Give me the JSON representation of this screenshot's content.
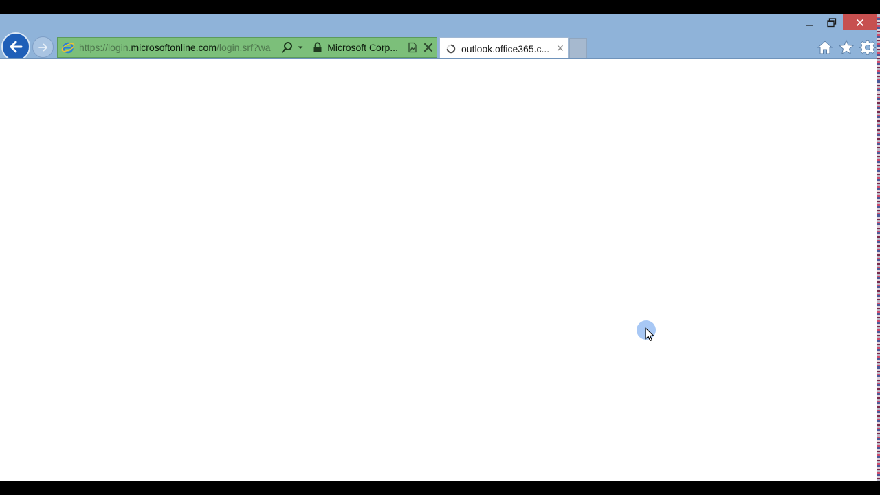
{
  "browser": {
    "address_bar": {
      "url_scheme": "https://",
      "url_sub": "login.",
      "url_host": "microsoftonline.com",
      "url_path": "/login.srf?wa",
      "site_identity": "Microsoft Corp..."
    },
    "tabs": [
      {
        "title": "outlook.office365.c...",
        "state": "loading"
      }
    ],
    "toolbar_icons": [
      "home-icon",
      "favorites-star-icon",
      "settings-gear-icon"
    ],
    "window_controls": [
      "minimize",
      "restore",
      "close"
    ]
  },
  "colors": {
    "chrome": "#8fb3d9",
    "address_bar_secure": "#7cbf7a",
    "close_button": "#c75050",
    "back_button": "#1f5fb8",
    "cursor_highlight": "#a8c8f5"
  }
}
